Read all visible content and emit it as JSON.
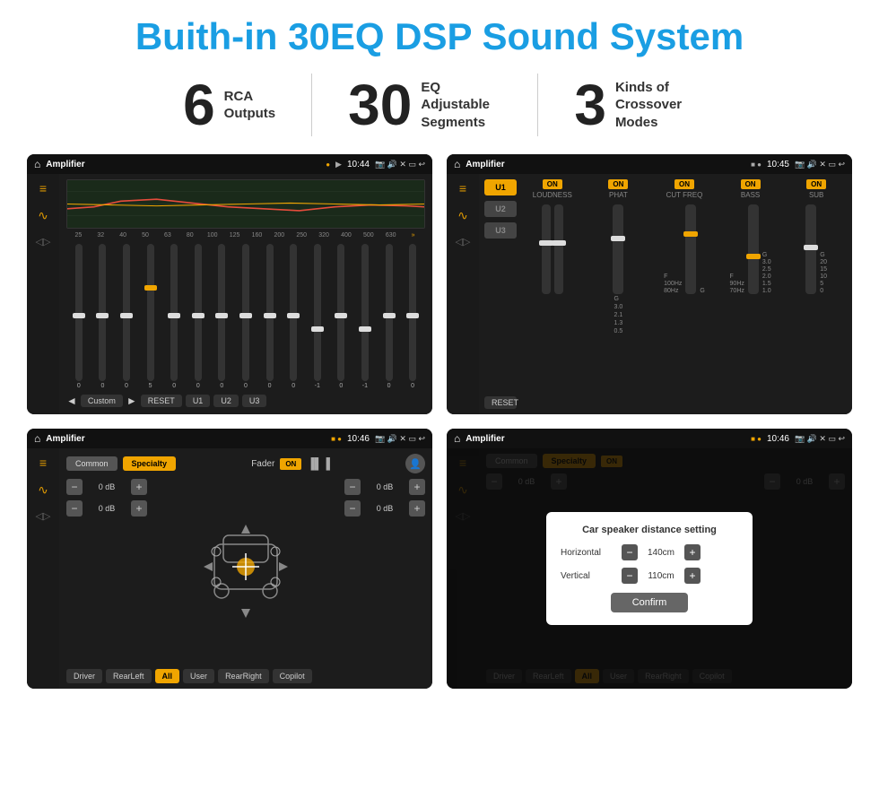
{
  "title": "Buith-in 30EQ DSP Sound System",
  "stats": [
    {
      "number": "6",
      "label": "RCA\nOutputs"
    },
    {
      "number": "30",
      "label": "EQ Adjustable\nSegments"
    },
    {
      "number": "3",
      "label": "Kinds of\nCrossover Modes"
    }
  ],
  "screens": {
    "eq": {
      "title": "Amplifier",
      "time": "10:44",
      "frequencies": [
        "25",
        "32",
        "40",
        "50",
        "63",
        "80",
        "100",
        "125",
        "160",
        "200",
        "250",
        "320",
        "400",
        "500",
        "630"
      ],
      "values": [
        "0",
        "0",
        "0",
        "5",
        "0",
        "0",
        "0",
        "0",
        "0",
        "0",
        "-1",
        "0",
        "-1"
      ],
      "presets": [
        "Custom",
        "RESET",
        "U1",
        "U2",
        "U3"
      ]
    },
    "crossover": {
      "title": "Amplifier",
      "time": "10:45",
      "presets": [
        "U1",
        "U2",
        "U3"
      ],
      "controls": [
        "LOUDNESS",
        "PHAT",
        "CUT FREQ",
        "BASS",
        "SUB"
      ]
    },
    "fader": {
      "title": "Amplifier",
      "time": "10:46",
      "tabs": [
        "Common",
        "Specialty"
      ],
      "fader_label": "Fader",
      "on_label": "ON",
      "db_values": [
        "0 dB",
        "0 dB",
        "0 dB",
        "0 dB"
      ],
      "buttons": [
        "Driver",
        "RearLeft",
        "All",
        "User",
        "RearRight",
        "Copilot"
      ]
    },
    "dialog": {
      "title": "Amplifier",
      "time": "10:46",
      "tabs": [
        "Common",
        "Specialty"
      ],
      "dialog_title": "Car speaker distance setting",
      "horizontal_label": "Horizontal",
      "horizontal_value": "140cm",
      "vertical_label": "Vertical",
      "vertical_value": "110cm",
      "confirm_label": "Confirm",
      "buttons": [
        "Driver",
        "RearLeft",
        "All",
        "User",
        "RearRight",
        "Copilot"
      ],
      "db_values": [
        "0 dB",
        "0 dB"
      ]
    }
  }
}
